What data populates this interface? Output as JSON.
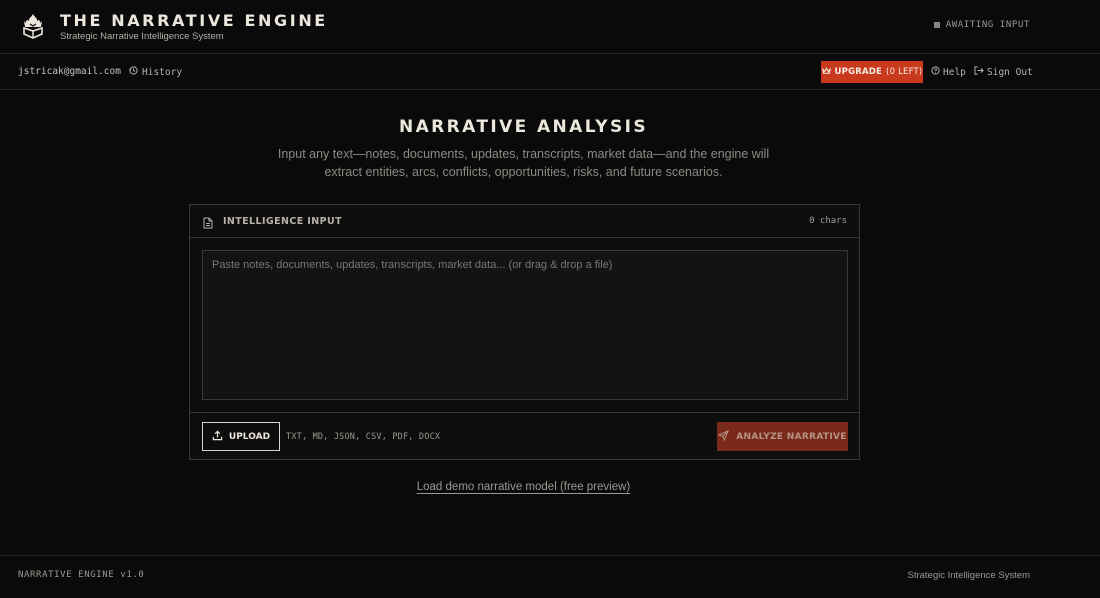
{
  "header": {
    "title": "THE NARRATIVE ENGINE",
    "subtitle": "Strategic Narrative Intelligence System",
    "status": "AWAITING INPUT",
    "logo_icon": "flame-crown-icon"
  },
  "account": {
    "email": "jstricak@gmail.com",
    "history_label": "History",
    "upgrade_label": "UPGRADE",
    "upgrade_count": "(0 LEFT)",
    "help_label": "Help",
    "signout_label": "Sign Out"
  },
  "main": {
    "title": "NARRATIVE ANALYSIS",
    "description": "Input any text—notes, documents, updates, transcripts, market data—and the engine will extract entities, arcs, conflicts, opportunities, risks, and future scenarios."
  },
  "panel": {
    "title": "INTELLIGENCE INPUT",
    "char_count": "0 chars",
    "placeholder": "Paste notes, documents, updates, transcripts, market data... (or drag & drop a file)",
    "value": "",
    "upload_label": "UPLOAD",
    "formats": "TXT, MD, JSON, CSV, PDF, DOCX",
    "analyze_label": "ANALYZE NARRATIVE"
  },
  "demo_link": "Load demo narrative model (free preview)",
  "footer": {
    "left": "NARRATIVE ENGINE v1.0",
    "right": "Strategic Intelligence System"
  },
  "colors": {
    "background": "#0b0a0b",
    "accent": "#c8391d",
    "accent_disabled": "#7a2a18",
    "border": "#3a3837"
  }
}
